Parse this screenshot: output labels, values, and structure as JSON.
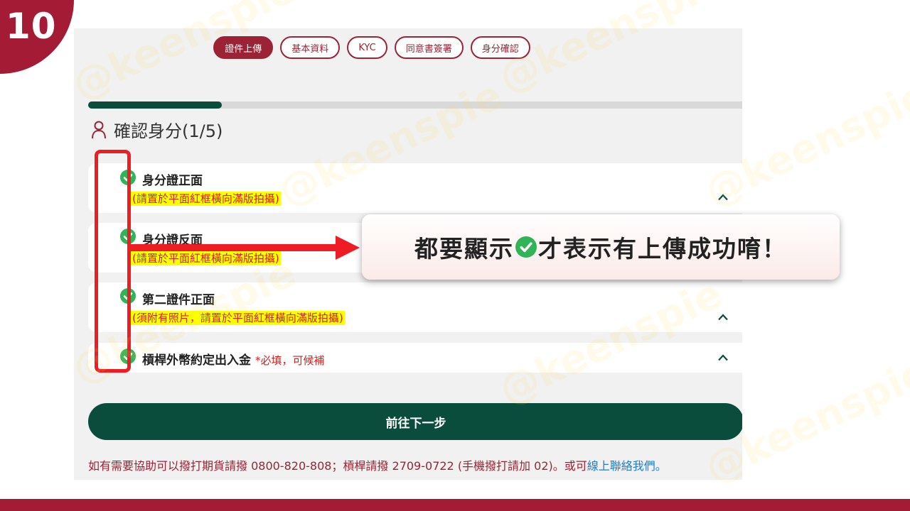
{
  "slide_number": "10",
  "tabs": [
    {
      "label": "證件上傳",
      "active": true
    },
    {
      "label": "基本資料",
      "active": false
    },
    {
      "label": "KYC",
      "active": false
    },
    {
      "label": "同意書簽署",
      "active": false
    },
    {
      "label": "身分確認",
      "active": false
    }
  ],
  "progress": {
    "fraction": 0.2
  },
  "section": {
    "title": "確認身分(1/5)"
  },
  "items": [
    {
      "title": "身分證正面",
      "note": "(請置於平面紅框橫向滿版拍攝)"
    },
    {
      "title": "身分證反面",
      "note": "(請置於平面紅框橫向滿版拍攝)"
    },
    {
      "title": "第二證件正面",
      "note": "(須附有照片，請置於平面紅框橫向滿版拍攝)"
    },
    {
      "title": "槓桿外幣約定出入金",
      "required_note": "*必填，可候補"
    }
  ],
  "next_button": {
    "label": "前往下一步"
  },
  "footer": {
    "text": "如有需要協助可以撥打期貨請撥 0800-820-808；槓桿請撥 2709-0722 (手機撥打請加 02)。或可",
    "link": "線上聯絡我們",
    "end": "。"
  },
  "callout": {
    "before": "都要顯示",
    "after": "才表示有上傳成功唷！"
  },
  "watermark": "@keenspie",
  "colors": {
    "brand_red": "#a31b35",
    "primary_green": "#0b4d3c",
    "check_green": "#2fb457",
    "highlight_red": "#ee1c25"
  }
}
